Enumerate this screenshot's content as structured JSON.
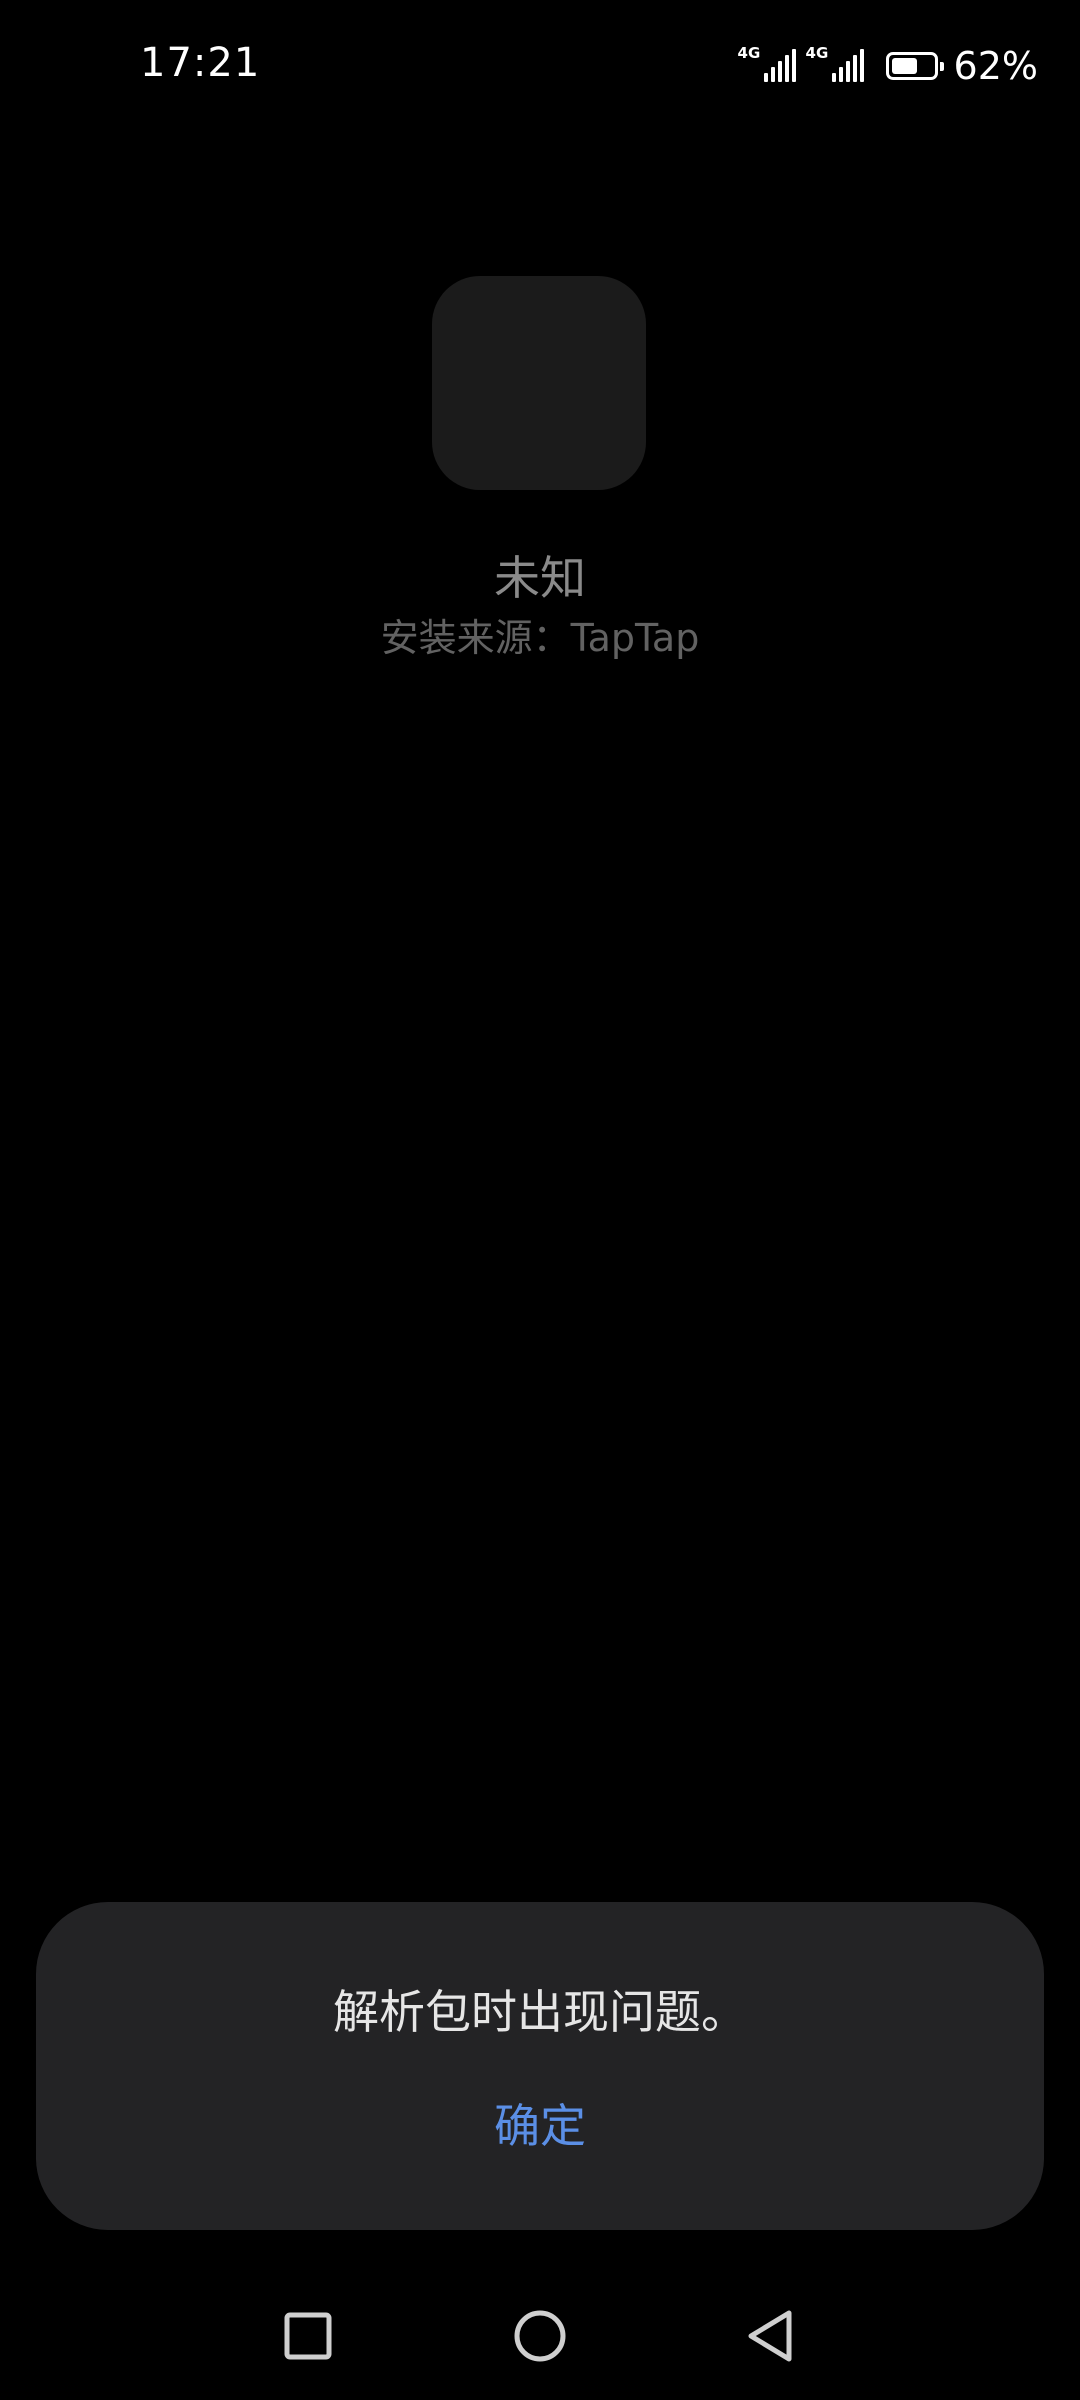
{
  "status_bar": {
    "time": "17:21",
    "sim1_network": "4G",
    "sim2_network": "4G",
    "battery_percent_text": "62%",
    "battery_level": 0.62
  },
  "app": {
    "icon": "blank-app-icon",
    "name": "未知",
    "install_source": "安装来源：TapTap"
  },
  "dialog": {
    "message": "解析包时出现问题。",
    "confirm_label": "确定"
  },
  "nav_bar": {
    "recent_icon": "square-recent-apps-icon",
    "home_icon": "circle-home-icon",
    "back_icon": "triangle-back-icon"
  },
  "colors": {
    "background": "#000000",
    "dialog_bg": "#232325",
    "accent": "#5b8fe6",
    "app_name": "#8a8a8a",
    "secondary_text": "#626262"
  }
}
